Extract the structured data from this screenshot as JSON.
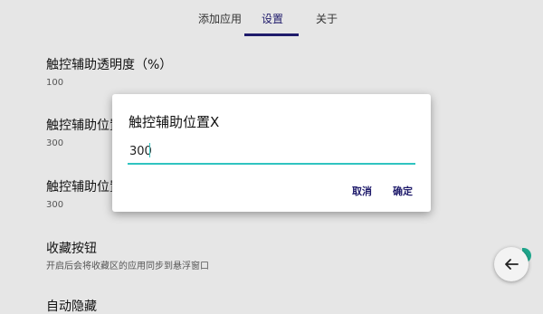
{
  "tabs": [
    {
      "label": "添加应用"
    },
    {
      "label": "设置"
    },
    {
      "label": "关于"
    }
  ],
  "settings": [
    {
      "title": "触控辅助透明度（%）",
      "value": "100"
    },
    {
      "title": "触控辅助位置X",
      "value": "300"
    },
    {
      "title": "触控辅助位置Y",
      "value": "300"
    },
    {
      "title": "收藏按钮",
      "value": "开启后会将收藏区的应用同步到悬浮窗口"
    },
    {
      "title": "自动隐藏",
      "value": ""
    }
  ],
  "dialog": {
    "title": "触控辅助位置X",
    "input_value": "300",
    "cancel_label": "取消",
    "confirm_label": "确定"
  },
  "fab": {
    "icon": "arrow-left-icon"
  },
  "colors": {
    "accent": "#1f1b6b",
    "input_underline": "#2fc4c0",
    "fab_dot": "#1fa68c"
  }
}
